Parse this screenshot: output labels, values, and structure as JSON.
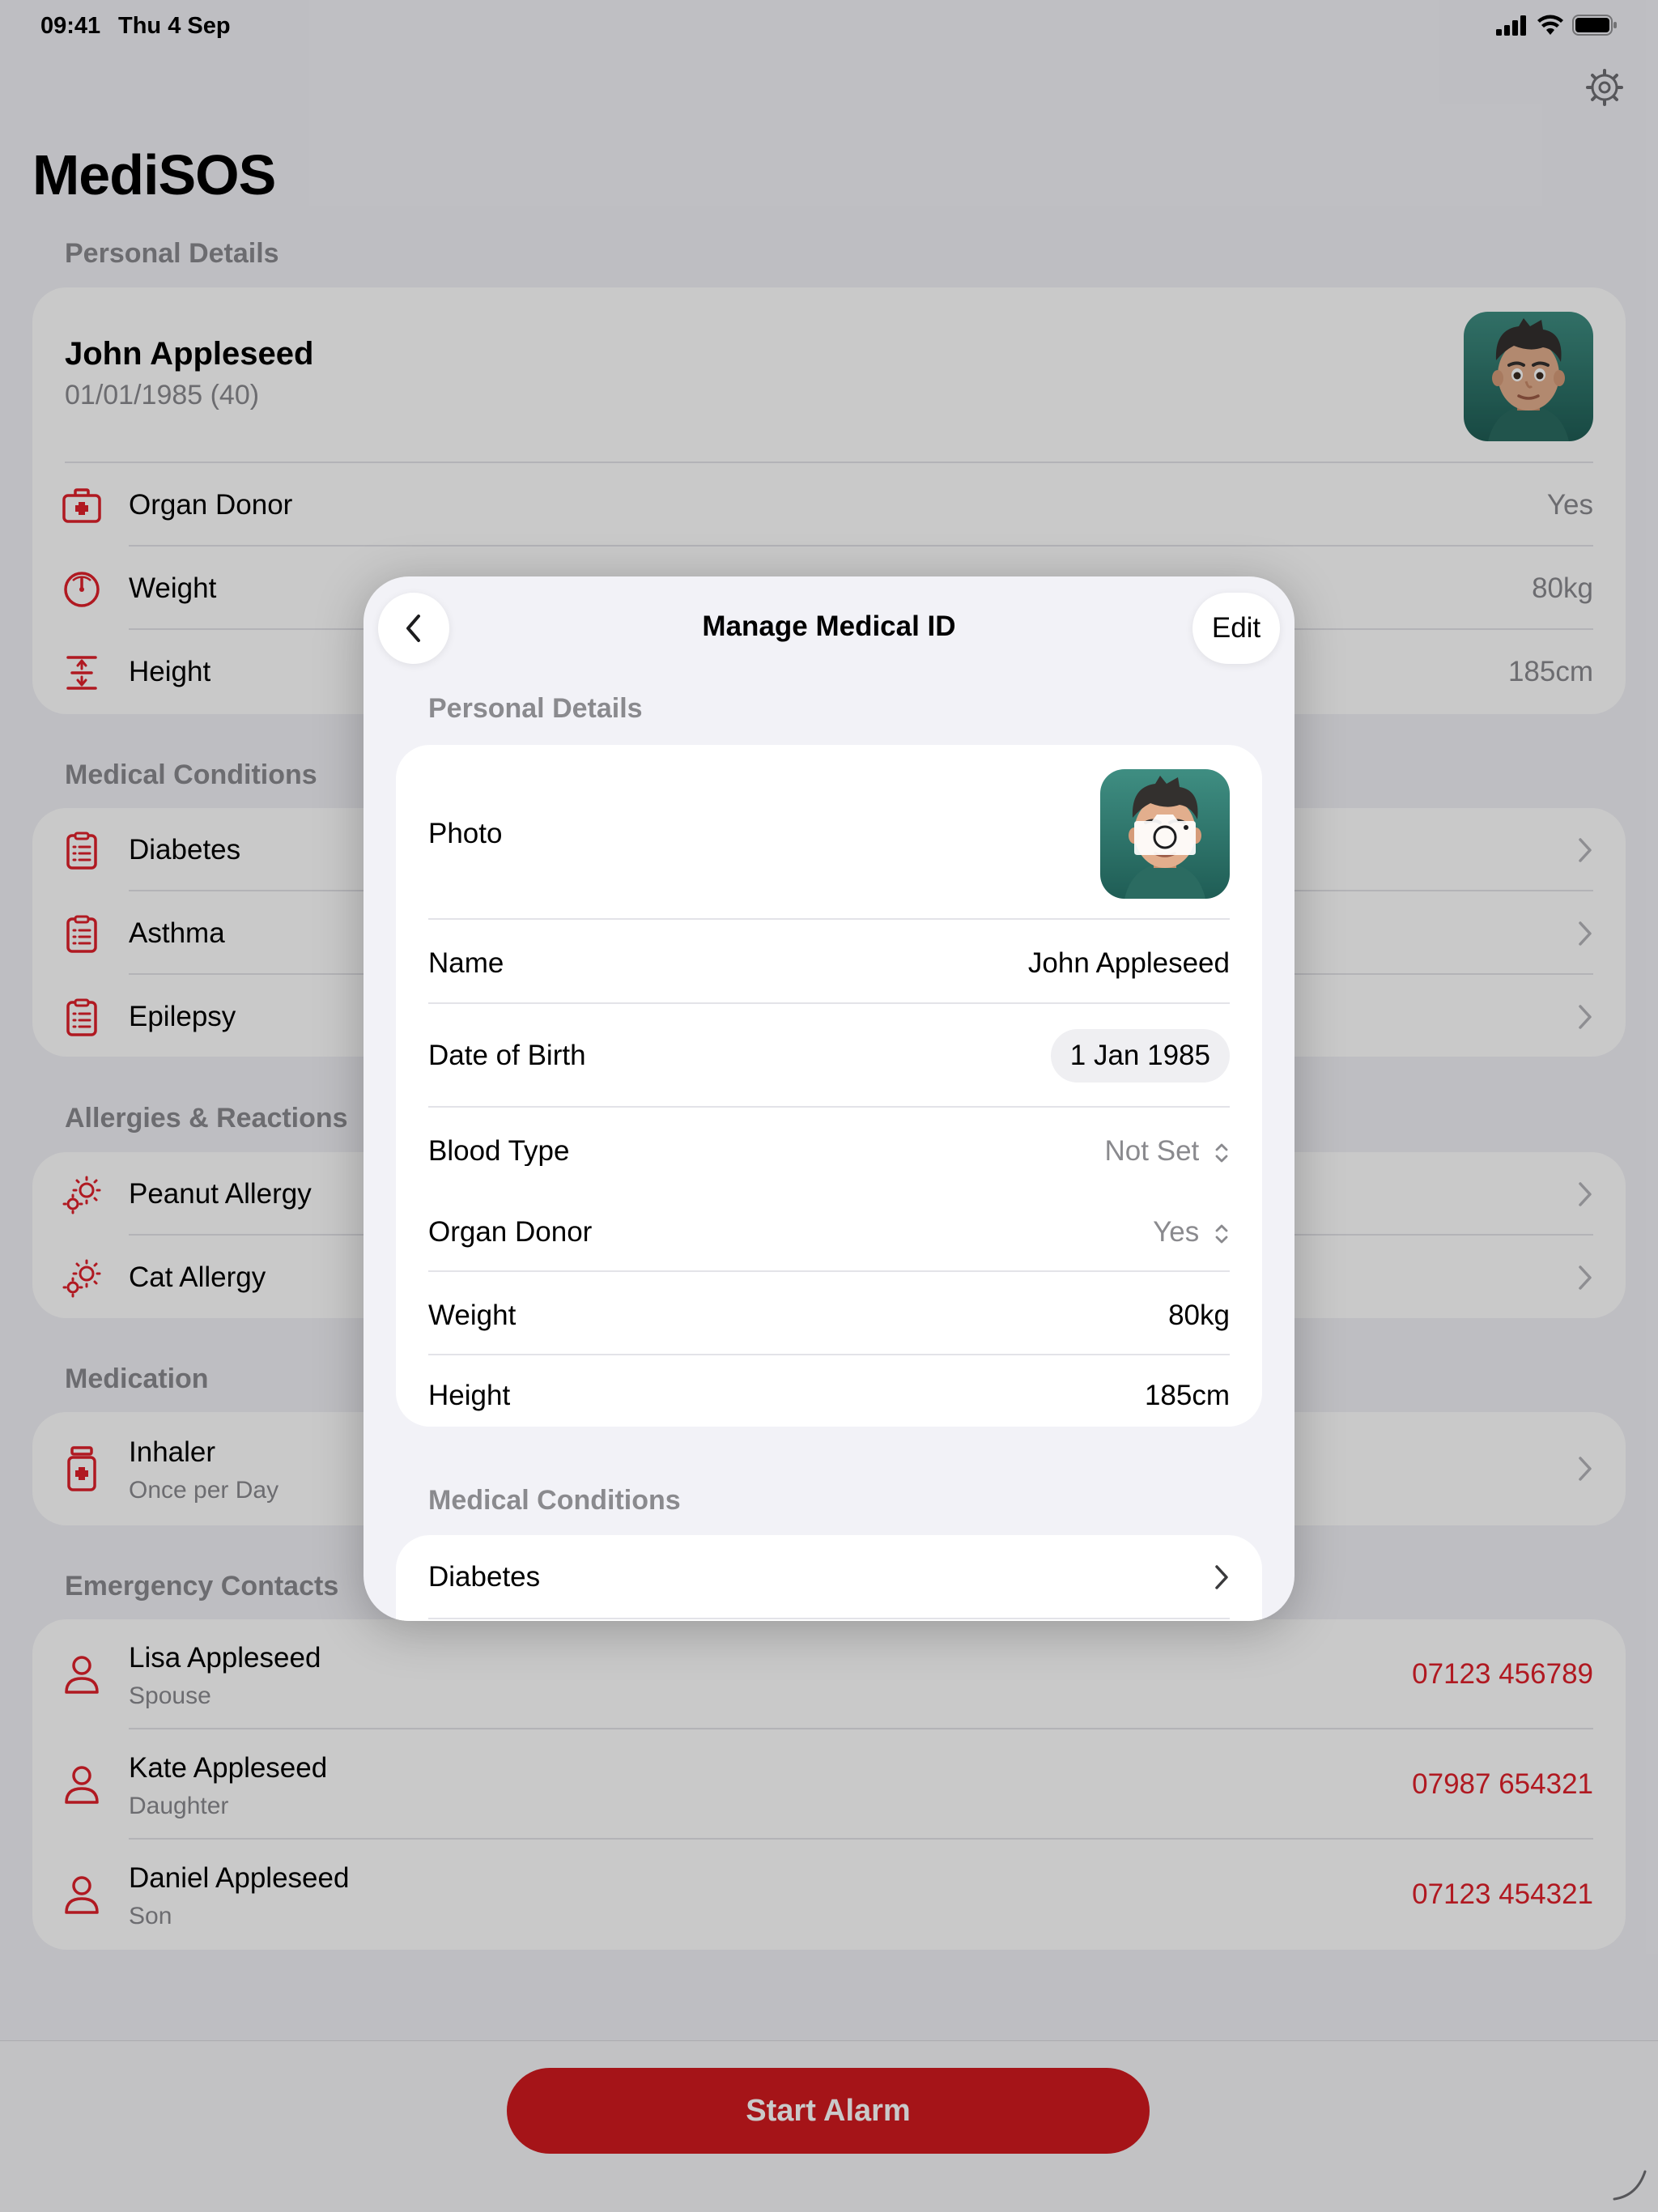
{
  "status_bar": {
    "time": "09:41",
    "date": "Thu 4 Sep"
  },
  "app": {
    "title": "MediSOS"
  },
  "personal": {
    "header": "Personal Details",
    "name": "John Appleseed",
    "dob": "01/01/1985 (40)",
    "rows": [
      {
        "label": "Organ Donor",
        "value": "Yes",
        "icon": "first-aid-icon"
      },
      {
        "label": "Weight",
        "value": "80kg",
        "icon": "scale-icon"
      },
      {
        "label": "Height",
        "value": "185cm",
        "icon": "height-icon"
      }
    ]
  },
  "conditions": {
    "header": "Medical Conditions",
    "items": [
      {
        "label": "Diabetes"
      },
      {
        "label": "Asthma"
      },
      {
        "label": "Epilepsy"
      }
    ]
  },
  "allergies": {
    "header": "Allergies & Reactions",
    "items": [
      {
        "label": "Peanut Allergy"
      },
      {
        "label": "Cat Allergy"
      }
    ]
  },
  "medication": {
    "header": "Medication",
    "items": [
      {
        "label": "Inhaler",
        "sub": "Once per Day"
      }
    ]
  },
  "contacts": {
    "header": "Emergency Contacts",
    "items": [
      {
        "name": "Lisa Appleseed",
        "relation": "Spouse",
        "phone": "07123 456789"
      },
      {
        "name": "Kate Appleseed",
        "relation": "Daughter",
        "phone": "07987 654321"
      },
      {
        "name": "Daniel Appleseed",
        "relation": "Son",
        "phone": "07123 454321"
      }
    ]
  },
  "bottom": {
    "start_alarm": "Start Alarm"
  },
  "modal": {
    "title": "Manage Medical ID",
    "edit_label": "Edit",
    "personal_header": "Personal Details",
    "photo_label": "Photo",
    "name_label": "Name",
    "name_value": "John Appleseed",
    "dob_label": "Date of Birth",
    "dob_value": "1 Jan 1985",
    "blood_label": "Blood Type",
    "blood_value": "Not Set",
    "donor_label": "Organ Donor",
    "donor_value": "Yes",
    "weight_label": "Weight",
    "weight_value": "80kg",
    "height_label": "Height",
    "height_value": "185cm",
    "conditions_header": "Medical Conditions",
    "conditions": [
      {
        "label": "Diabetes"
      }
    ]
  },
  "colors": {
    "accent": "#e0202a",
    "secondary_text": "#8a8a8e",
    "background": "#f2f2f7",
    "avatar_bg": "#2f7a6f"
  }
}
